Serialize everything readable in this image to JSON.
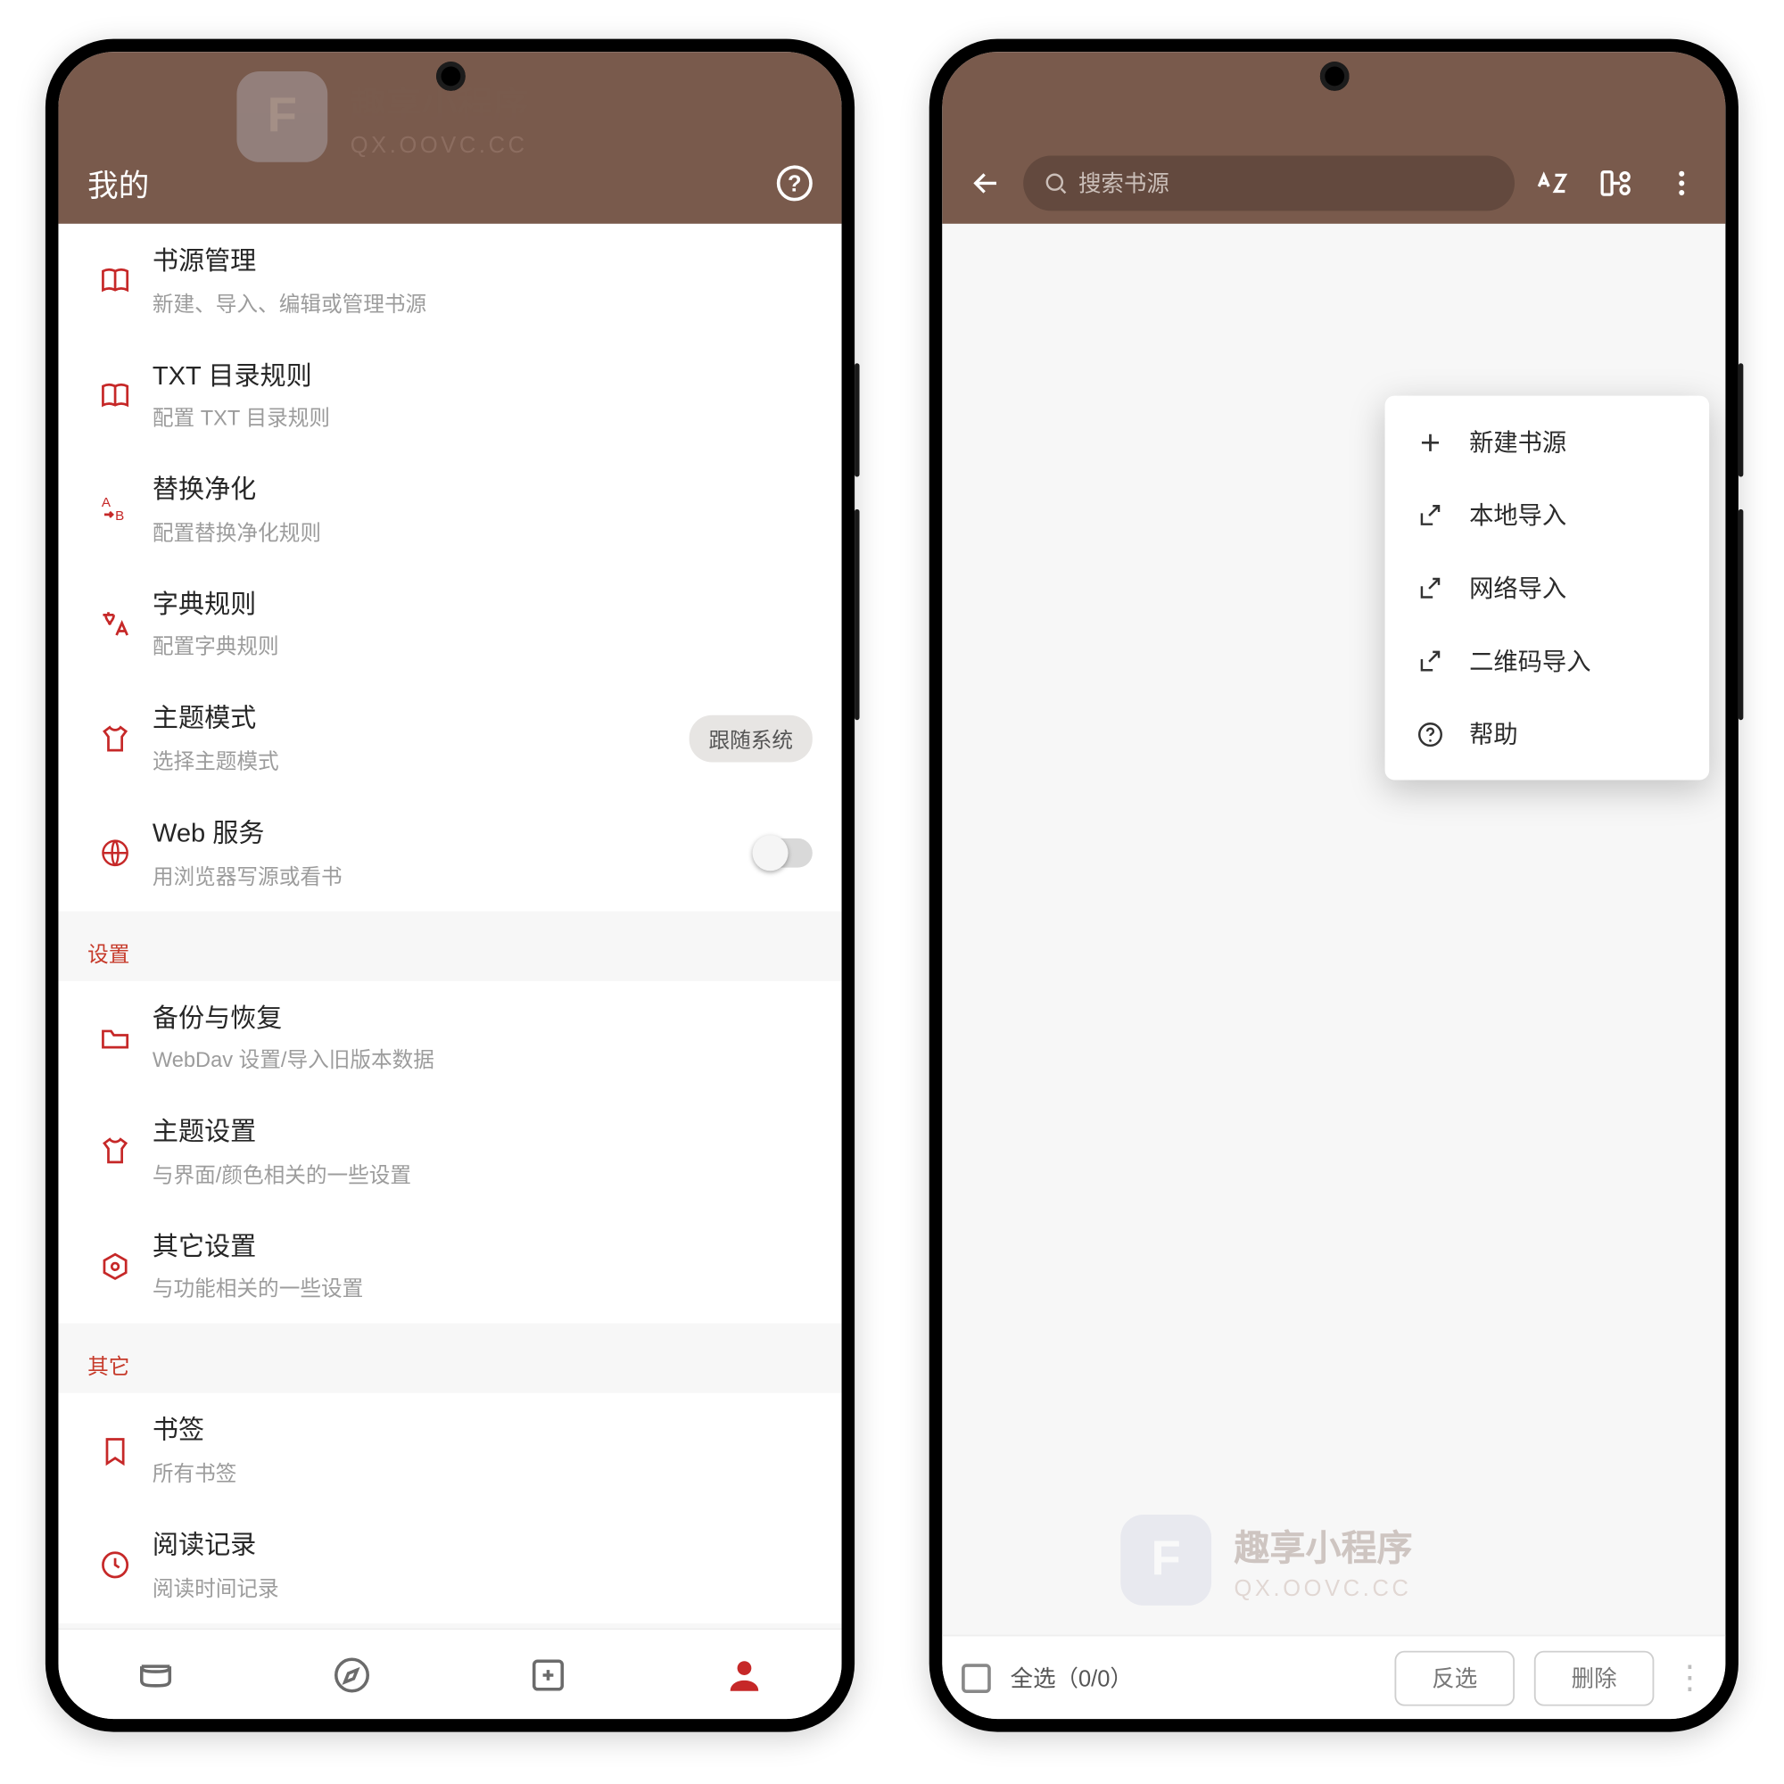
{
  "left": {
    "header_title": "我的",
    "items": [
      {
        "title": "书源管理",
        "sub": "新建、导入、编辑或管理书源"
      },
      {
        "title": "TXT 目录规则",
        "sub": "配置 TXT 目录规则"
      },
      {
        "title": "替换净化",
        "sub": "配置替换净化规则"
      },
      {
        "title": "字典规则",
        "sub": "配置字典规则"
      },
      {
        "title": "主题模式",
        "sub": "选择主题模式",
        "chip": "跟随系统"
      },
      {
        "title": "Web 服务",
        "sub": "用浏览器写源或看书",
        "toggle": true
      }
    ],
    "section_settings": "设置",
    "settings": [
      {
        "title": "备份与恢复",
        "sub": "WebDav 设置/导入旧版本数据"
      },
      {
        "title": "主题设置",
        "sub": "与界面/颜色相关的一些设置"
      },
      {
        "title": "其它设置",
        "sub": "与功能相关的一些设置"
      }
    ],
    "section_other": "其它",
    "other": [
      {
        "title": "书签",
        "sub": "所有书签"
      },
      {
        "title": "阅读记录",
        "sub": "阅读时间记录"
      }
    ]
  },
  "right": {
    "search_placeholder": "搜索书源",
    "menu": [
      "新建书源",
      "本地导入",
      "网络导入",
      "二维码导入",
      "帮助"
    ],
    "select_all": "全选（0/0）",
    "invert": "反选",
    "delete": "删除"
  },
  "watermark": {
    "t1": "趣享小程序",
    "t2": "QX.OOVC.CC"
  }
}
